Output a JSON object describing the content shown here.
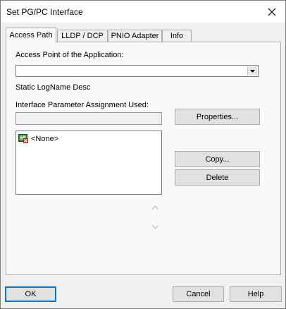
{
  "window": {
    "title": "Set PG/PC Interface"
  },
  "tabs": [
    {
      "label": "Access Path"
    },
    {
      "label": "LLDP / DCP"
    },
    {
      "label": "PNIO Adapter"
    },
    {
      "label": "Info"
    }
  ],
  "access_point": {
    "label": "Access Point of the Application:",
    "value": ""
  },
  "static_logname": "Static LogName Desc",
  "interface_param": {
    "label": "Interface Parameter Assignment Used:",
    "value": ""
  },
  "buttons": {
    "properties": "Properties...",
    "copy": "Copy...",
    "delete": "Delete",
    "ok": "OK",
    "cancel": "Cancel",
    "help": "Help"
  },
  "interface_list": [
    {
      "label": "<None>",
      "icon": "network-adapter-none-icon"
    }
  ]
}
